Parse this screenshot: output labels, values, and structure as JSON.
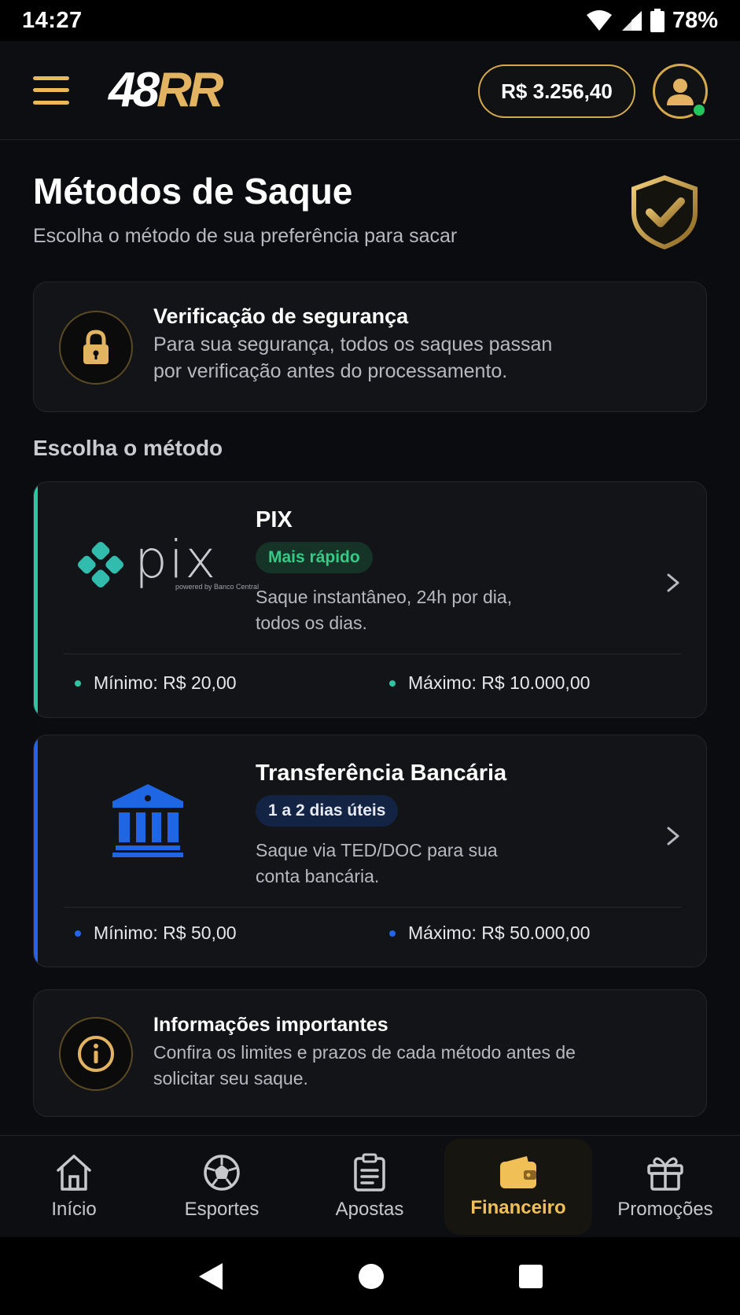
{
  "status_bar": {
    "time": "14:27",
    "battery": "78%"
  },
  "header": {
    "logo_white": "48",
    "logo_gold": "RR",
    "balance": "R$ 3.256,40"
  },
  "page": {
    "title": "Métodos de Saque",
    "subtitle": "Escolha o método de sua preferência para sacar"
  },
  "security": {
    "title": "Verificação de segurança",
    "line1": "Para sua segurança, todos os saques passan",
    "line2": "por verificação antes do processamento."
  },
  "methods_label": "Escolha o método",
  "pix": {
    "logo_text": "pix",
    "logo_caption": "powered by Banco Central",
    "title": "PIX",
    "badge": "Mais rápido",
    "desc_line1": "Saque instantâneo, 24h por dia,",
    "desc_line2": "todos os dias.",
    "min": "Mínimo: R$ 20,00",
    "max": "Máximo: R$ 10.000,00",
    "accent": "#2fc5a3"
  },
  "bank": {
    "title": "Transferência Bancária",
    "badge": "1 a 2 dias úteis",
    "desc_line1": "Saque via TED/DOC para sua",
    "desc_line2": "conta bancária.",
    "min": "Mínimo: R$ 50,00",
    "max": "Máximo: R$ 50.000,00",
    "accent": "#2563eb"
  },
  "info": {
    "title": "Informações importantes",
    "line1": "Confira os limites e prazos de cada método antes de",
    "line2": "solicitar seu saque."
  },
  "bottom_nav": [
    {
      "label": "Início",
      "icon": "home-icon"
    },
    {
      "label": "Esportes",
      "icon": "soccer-ball-icon"
    },
    {
      "label": "Apostas",
      "icon": "clipboard-icon"
    },
    {
      "label": "Financeiro",
      "icon": "wallet-icon",
      "active": true
    },
    {
      "label": "Promoções",
      "icon": "gift-icon"
    }
  ],
  "colors": {
    "gold": "#e2b461",
    "background": "#0b0c0f",
    "card": "#131418"
  }
}
